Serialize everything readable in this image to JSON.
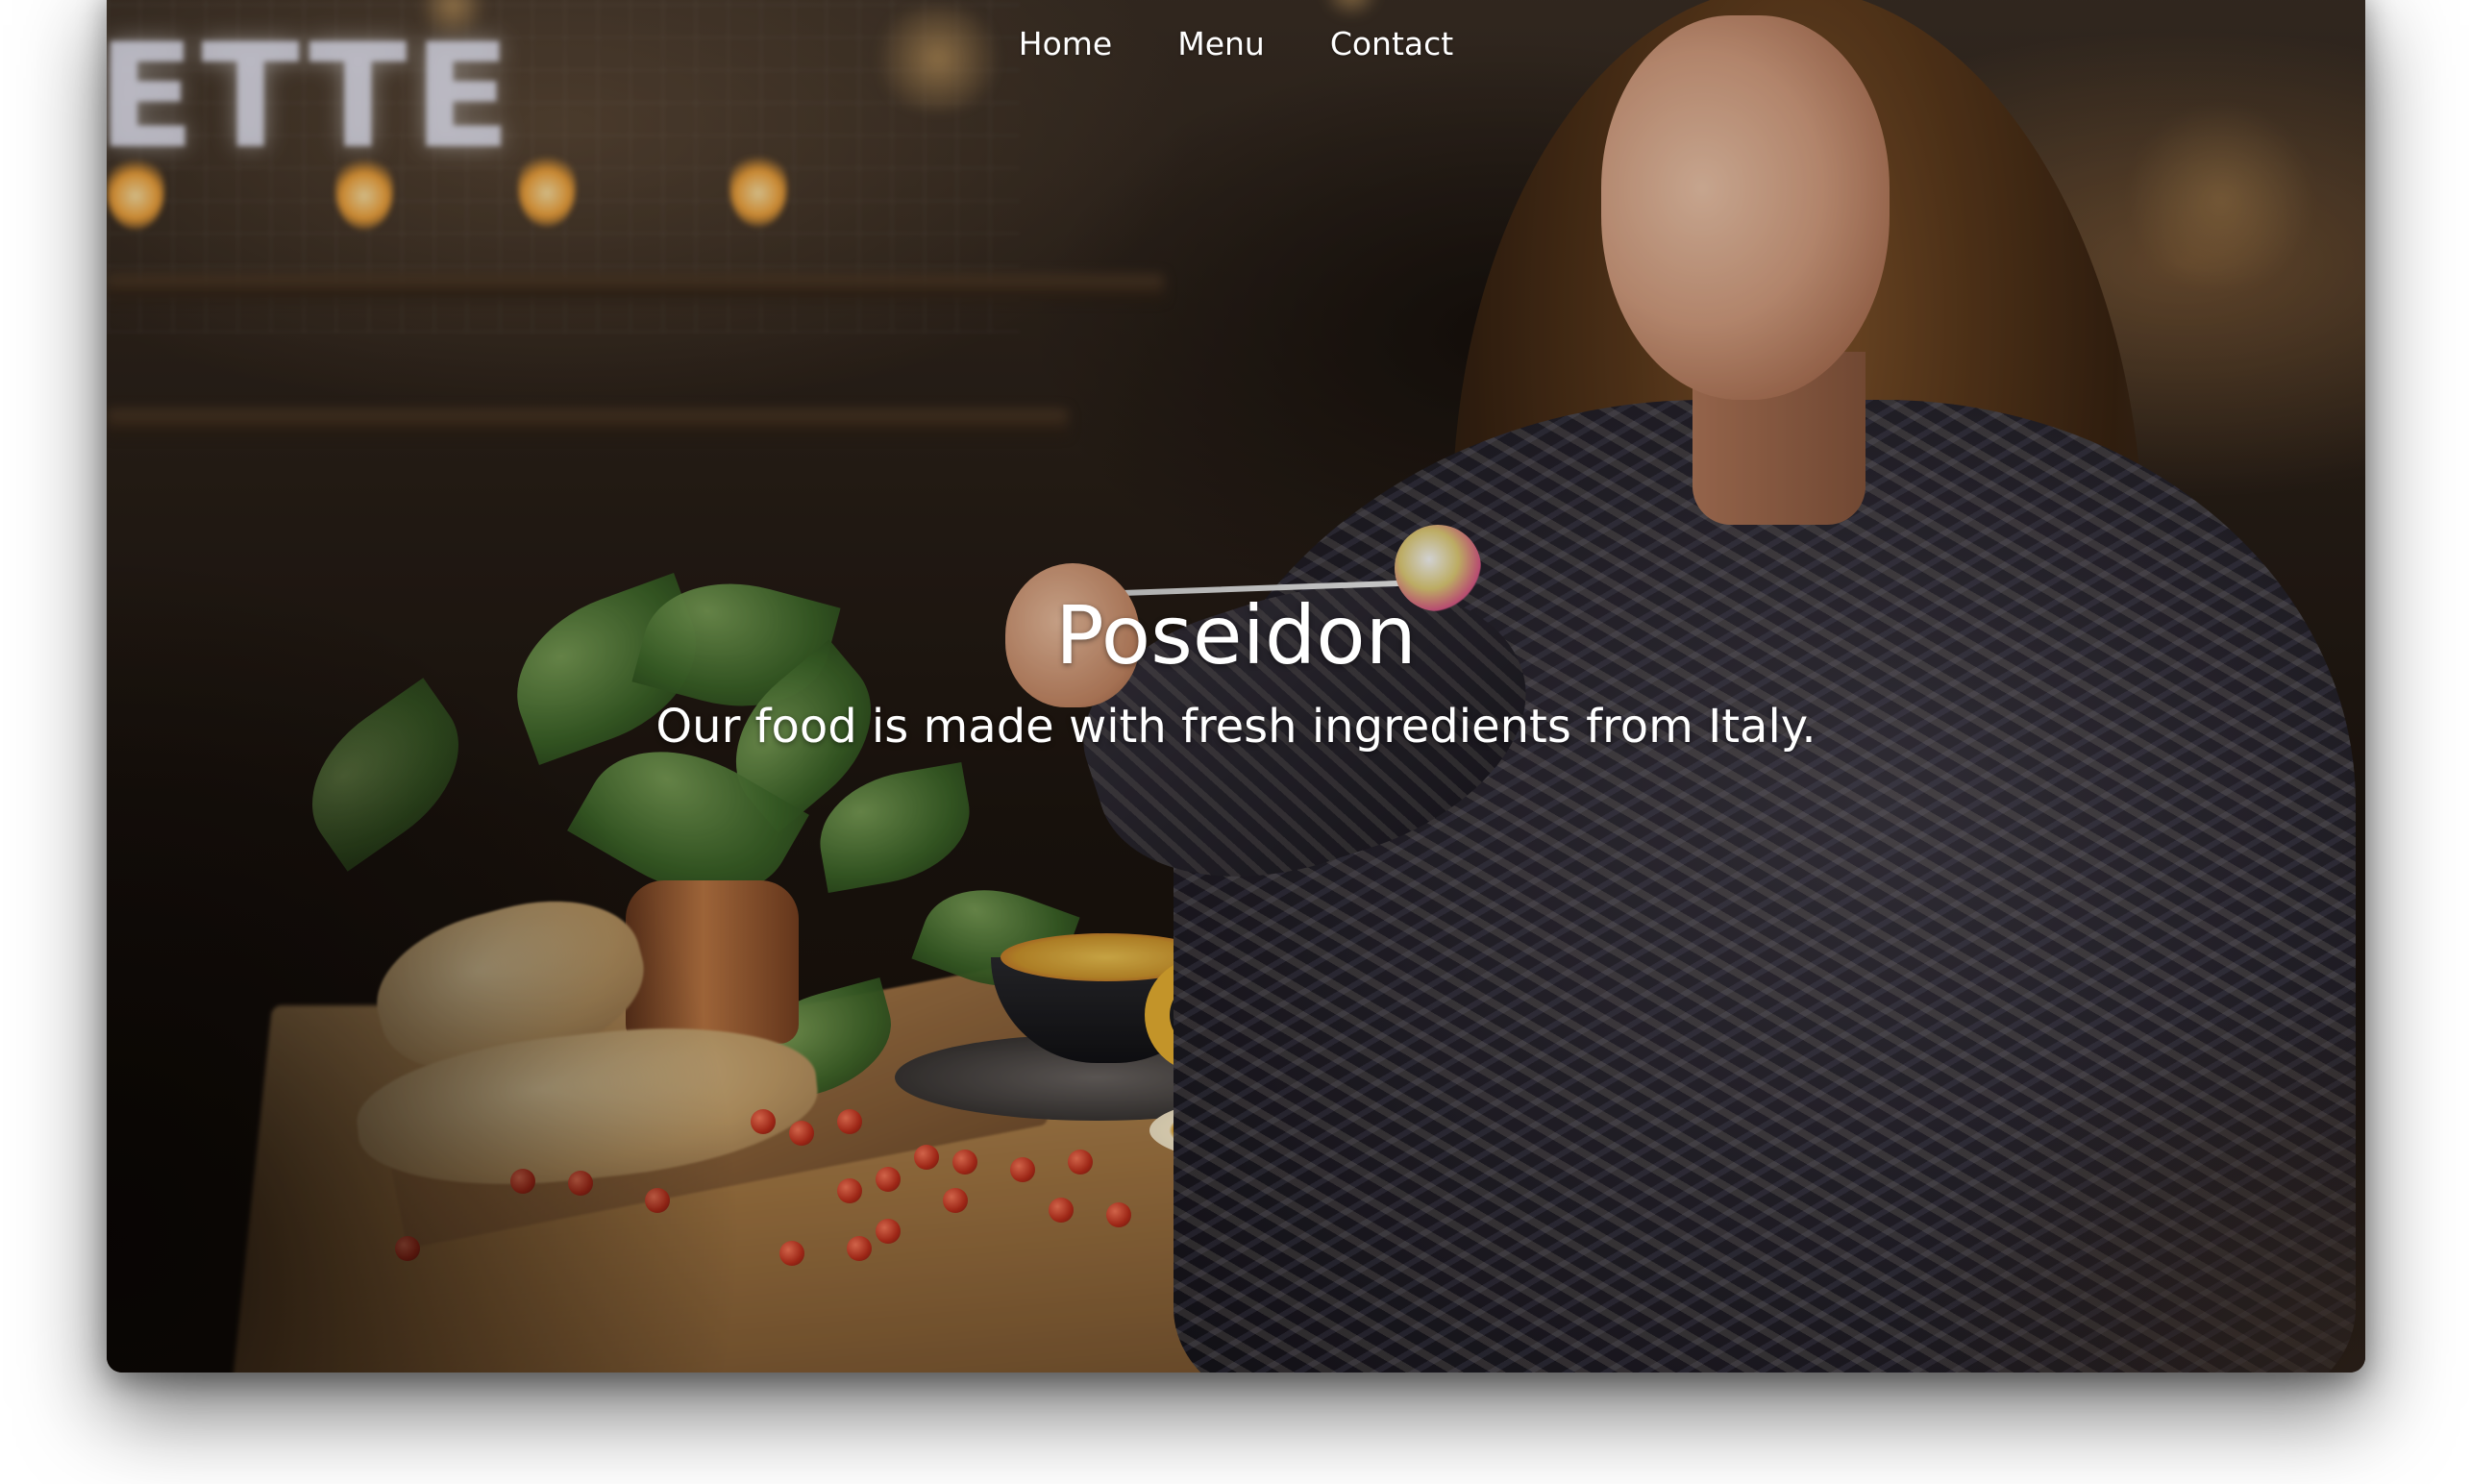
{
  "nav": {
    "items": [
      {
        "label": "Home"
      },
      {
        "label": "Menu"
      },
      {
        "label": "Contact"
      }
    ]
  },
  "hero": {
    "title": "Poseidon",
    "subtitle": "Our food is made with fresh ingredients from Italy.",
    "background_image": "woman-eating-pasta-at-cafe-table-photo"
  },
  "colors": {
    "nav_text": "#ffffff",
    "hero_text": "#ffffff",
    "page_background": "#ffffff"
  }
}
